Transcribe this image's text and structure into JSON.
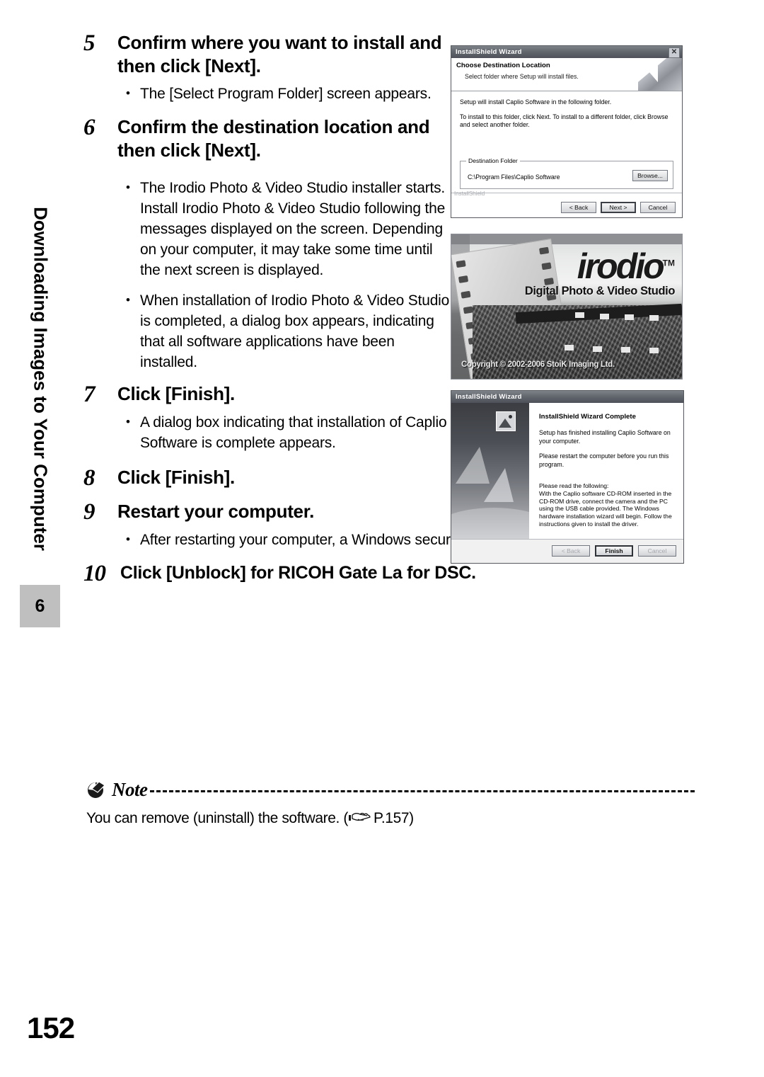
{
  "sidebar": {
    "chapter_title": "Downloading Images to Your Computer",
    "chapter_number": "6"
  },
  "page_number": "152",
  "steps": [
    {
      "number": "5",
      "title": "Confirm where you want to install and then click [Next].",
      "bullets": [
        "The [Select Program Folder] screen appears."
      ]
    },
    {
      "number": "6",
      "title": "Confirm the destination location and then click [Next].",
      "bullets": [
        "The Irodio Photo & Video Studio installer starts. Install Irodio Photo & Video Studio following the messages displayed on the screen. Depending on your computer, it may take some time until the next screen is displayed.",
        "When installation of Irodio Photo & Video Studio is completed, a dialog box appears, indicating that all software applications have been installed."
      ]
    },
    {
      "number": "7",
      "title": "Click [Finish].",
      "bullets": [
        "A dialog box indicating that installation of Caplio Software is complete appears."
      ]
    },
    {
      "number": "8",
      "title": "Click [Finish].",
      "bullets": []
    },
    {
      "number": "9",
      "title": "Restart your computer.",
      "bullets": [
        "After restarting your computer, a Windows security warning message appears."
      ]
    },
    {
      "number": "10",
      "title": "Click [Unblock] for RICOH Gate La for DSC.",
      "bullets": []
    }
  ],
  "note": {
    "heading": "Note",
    "body_before": "You can remove (uninstall) the software. (",
    "reference": "P.157",
    "body_after": ")"
  },
  "figures": {
    "dialog_destination": {
      "title": "InstallShield Wizard",
      "header_title": "Choose Destination Location",
      "header_subtitle": "Select folder where Setup will install files.",
      "paragraph1": "Setup will install Caplio Software in the following folder.",
      "paragraph2": "To install to this folder, click Next. To install to a different folder, click Browse and select another folder.",
      "group_legend": "Destination Folder",
      "path_value": "C:\\Program Files\\Caplio Software",
      "browse_label": "Browse...",
      "installshield_label": "InstallShield",
      "buttons": {
        "back": "< Back",
        "next": "Next >",
        "cancel": "Cancel"
      },
      "close_glyph": "✕"
    },
    "irodio_splash": {
      "logo": "irodio",
      "trademark": "TM",
      "tagline": "Digital Photo & Video Studio",
      "copyright": "Copyright © 2002-2006 StoiK Imaging Ltd."
    },
    "dialog_complete": {
      "title": "InstallShield Wizard",
      "heading": "InstallShield Wizard Complete",
      "paragraph1": "Setup has finished installing Caplio Software on your computer.",
      "paragraph2": "Please restart the computer before you run this program.",
      "read_following": "Please read the following:",
      "read_body": "With the Caplio software CD-ROM inserted in the CD-ROM drive, connect the camera and the PC using the USB cable provided. The Windows hardware installation wizard will begin. Follow the instructions given to install the driver.",
      "buttons": {
        "back": "< Back",
        "finish": "Finish",
        "cancel": "Cancel"
      }
    }
  }
}
